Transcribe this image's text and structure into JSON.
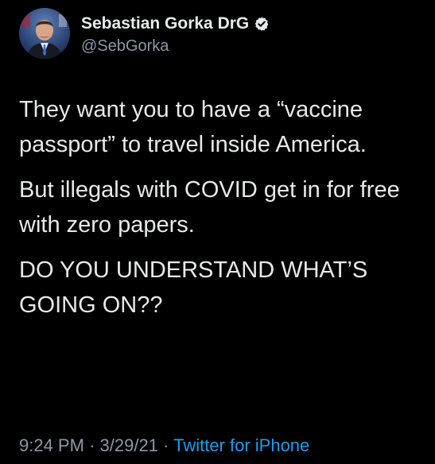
{
  "author": {
    "display_name": "Sebastian Gorka DrG",
    "handle": "@SebGorka",
    "verified": true,
    "avatar_icon": "profile-photo-icon",
    "verified_icon": "verified-badge-icon"
  },
  "tweet": {
    "paragraphs": [
      "They want you to have a “vaccine passport” to travel inside America.",
      "But illegals with COVID get in for free with zero papers.",
      "DO YOU UNDERSTAND WHAT’S GOING ON??"
    ],
    "time": "9:24 PM",
    "separator": "·",
    "date": "3/29/21",
    "source": "Twitter for iPhone"
  },
  "colors": {
    "background": "#000000",
    "primary_text": "#e7e9ea",
    "secondary_text": "#8b98a5",
    "link": "#1d9bf0"
  }
}
